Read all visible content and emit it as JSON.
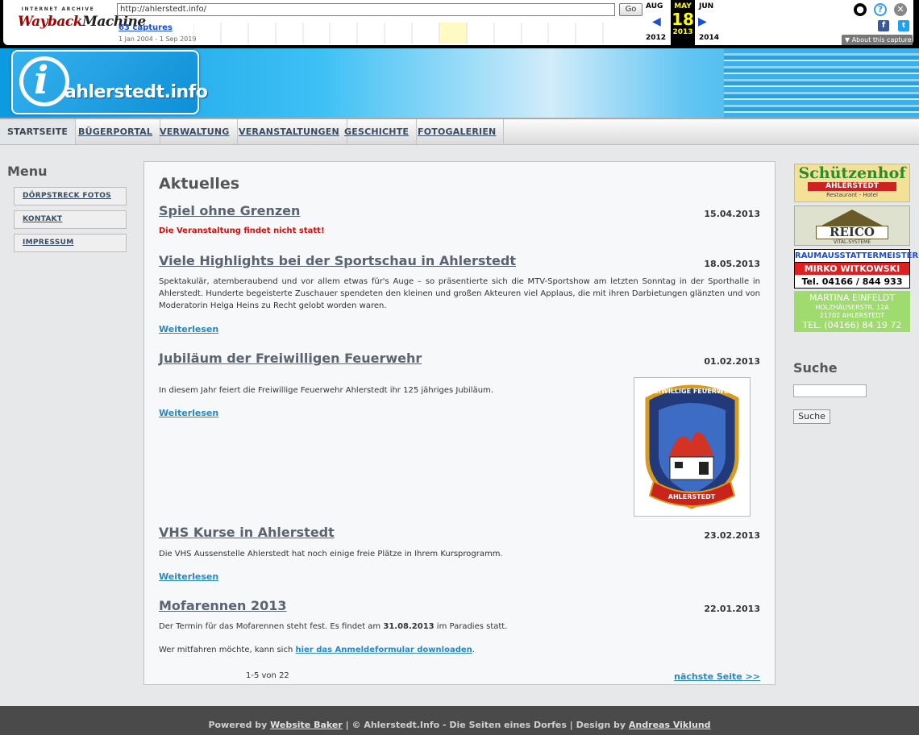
{
  "wayback": {
    "url": "http://ahlerstedt.info/",
    "go_label": "Go",
    "logo_top": "INTERNET ARCHIVE",
    "logo_main_1": "Wayback",
    "logo_main_2": "Machine",
    "captures": "63 captures",
    "range": "1 Jan 2004 - 1 Sep 2019",
    "prev_month": "AUG",
    "prev_year": "2012",
    "cur_month": "MAY",
    "cur_day": "18",
    "cur_year": "2013",
    "next_month": "JUN",
    "next_year": "2014",
    "about": "About this capture"
  },
  "header": {
    "logo_letter": "i",
    "logo_text": "ahlerstedt.info"
  },
  "nav": {
    "items": [
      {
        "label": "STARTSEITE"
      },
      {
        "label": "BÜGERPORTAL"
      },
      {
        "label": "VERWALTUNG"
      },
      {
        "label": "VERANSTALTUNGEN"
      },
      {
        "label": "GESCHICHTE"
      },
      {
        "label": "FOTOGALERIEN"
      }
    ]
  },
  "menu": {
    "title": "Menu",
    "items": [
      {
        "label": "DÖRPSTRECK FOTOS"
      },
      {
        "label": "KONTAKT"
      },
      {
        "label": "IMPRESSUM"
      }
    ]
  },
  "content": {
    "heading": "Aktuelles",
    "articles": [
      {
        "title": "Spiel ohne Grenzen",
        "date": "15.04.2013",
        "notice": "Die Veranstaltung findet nicht statt!"
      },
      {
        "title": "Viele Highlights bei der Sportschau in Ahlerstedt",
        "date": "18.05.2013",
        "text": "Spektakulär, atemberaubend und vor allem etwas für's Auge – so präsentierte sich die MTV-Sportshow am letzten Sonntag in der Sporthalle in Ahlerstedt. Hunderte begeisterte Zuschauer spendeten den kleinen und großen Akteuren viel Applaus, die mit ihren Darbietungen glänzten und von Moderatorin Helga Heins zu Recht gelobt worden waren.",
        "more": "Weiterlesen"
      },
      {
        "title": "Jubiläum der Freiwilligen Feuerwehr",
        "date": "01.02.2013",
        "text": "In diesem Jahr feiert die Freiwillige Feuerwehr Ahlerstedt ihr 125 jähriges Jubiläum.",
        "more": "Weiterlesen",
        "badge_top": "FREIWILLIGE FEUERWEHR",
        "badge_bottom": "AHLERSTEDT"
      },
      {
        "title": "VHS Kurse in Ahlerstedt",
        "date": "23.02.2013",
        "text": "Die VHS Aussenstelle Ahlerstedt hat noch einige freie Plätze in Ihrem Kursprogramm.",
        "more": "Weiterlesen"
      },
      {
        "title": "Mofarennen 2013",
        "date": "22.01.2013",
        "text_before": "Der Termin für das Mofarennen steht fest. Es findet am ",
        "text_bold": "31.08.2013",
        "text_after": " im Paradies statt.",
        "text2_before": "Wer mitfahren möchte, kann sich ",
        "text2_link": "hier das Anmeldeformular downloaden",
        "text2_after": "."
      }
    ],
    "pager_count": "1-5 von 22",
    "pager_next": "nächste Seite >>"
  },
  "ads": {
    "ad1_line1": "Schützenhof",
    "ad1_line2": "AHLERSTEDT",
    "ad1_line3": "Restaurant - Hotel",
    "ad2_line1": "REICO",
    "ad2_line2": "VITAL-SYSTEME",
    "ad3_line1": "RAUMAUSSTATTERMEISTER",
    "ad3_line2": "MIRKO WITKOWSKI",
    "ad3_line3": "Tel. 04166 / 844 933",
    "ad4_line1": "MARTINA EINFELDT",
    "ad4_line2": "HOLZHÄUSERSTR. 12A",
    "ad4_line3": "21702 AHLERSTEDT",
    "ad4_line4": "TEL. (04166) 84 19 72"
  },
  "search": {
    "title": "Suche",
    "button": "Suche"
  },
  "footer": {
    "powered": "Powered by ",
    "powered_link": "Website Baker",
    "middle": " | © Ahlerstedt.Info - Die Seiten eines Dorfes |  Design by ",
    "design_link": "Andreas Viklund"
  },
  "colors": {
    "accent_link": "#2a87bf",
    "notice_red": "#d21010",
    "header_blue": "#12a8ea"
  }
}
